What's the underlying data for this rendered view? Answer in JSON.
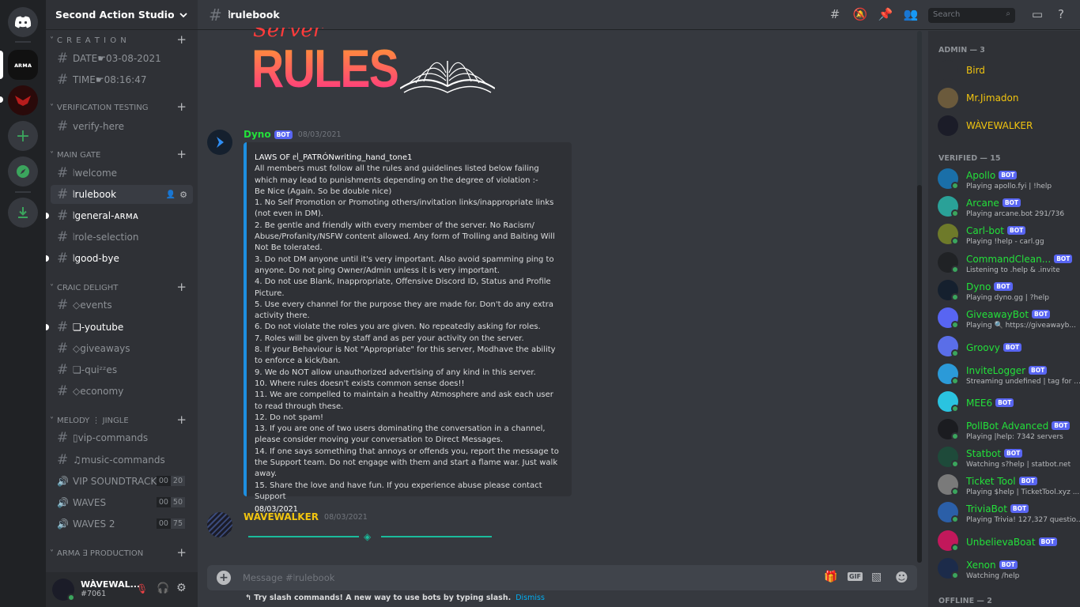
{
  "server": {
    "name": "Second Action Studio"
  },
  "categories": [
    {
      "name": "C R E A T I O N"
    },
    {
      "name": "VERIFICATION TESTING"
    },
    {
      "name": "MAIN GATE"
    },
    {
      "name": "CRAIC DELIGHT"
    },
    {
      "name": "MELODY ⋮ JINGLE"
    },
    {
      "name": "ARMA ∃ PRODUCTION"
    }
  ],
  "channels": {
    "date": "DATE☛03-08-2021",
    "time": "TIME☛08:16:47",
    "verify": "verify-here",
    "welcome": "⦚welcome",
    "rulebook": "⦚rulebook",
    "general": "⦚general-ᴀʀᴍᴀ",
    "role_selection": "⦚role-selection",
    "goodbye": "⦚good-bye",
    "events": "◇events",
    "youtube": "❏-youtube",
    "giveaways": "◇giveaways",
    "quizzes": "❏-quiᶻᶻes",
    "economy": "◇economy",
    "vip_commands": "▯vip-commands",
    "music_commands": "♫music-commands"
  },
  "voice": [
    {
      "name": "VIP SOUNDTRACK",
      "a": "00",
      "b": "20"
    },
    {
      "name": "WAVES",
      "a": "00",
      "b": "50"
    },
    {
      "name": "WAVES 2",
      "a": "00",
      "b": "75"
    }
  ],
  "user": {
    "name": "WÀVEWAL...",
    "tag": "#7061"
  },
  "topbar": {
    "channel": "⦚rulebook",
    "search_placeholder": "Search"
  },
  "banner": {
    "small": "Server",
    "big": "RULES"
  },
  "messages": [
    {
      "author": "Dyno",
      "bot": "BOT",
      "time": "08/03/2021"
    },
    {
      "author": "WÀVEWALKER",
      "time": "08/03/2021"
    }
  ],
  "embed": {
    "title": "LAWS OF ᥱᥣ_PATRÓNwriting_hand_tone1",
    "lines": [
      "All members must follow all the rules and guidelines listed below failing which may lead to punishments depending on the degree of violation :-",
      "Be Nice (Again. So be double nice)",
      "1. No Self Promotion or Promoting others/invitation links/inappropriate links (not even in DM).",
      "2. Be gentle and friendly with every member of the server. No Racism/ Abuse/Profanity/NSFW content allowed. Any form of Trolling and Baiting Will Not Be tolerated.",
      "3. Do not DM anyone until it's very important. Also avoid spamming ping to anyone. Do not ping Owner/Admin unless it is very important.",
      "4. Do not use Blank, Inappropriate, Offensive Discord ID, Status and Profile Picture.",
      "5. Use every channel for the purpose they are made for. Don't do any extra activity there.",
      "6. Do not violate the roles you are given. No repeatedly asking for roles.",
      "7. Roles will be given by staff and as per your activity on the server.",
      "8. If your Behaviour is Not \"Appropriate\" for this server, Modhave the ability to enforce a kick/ban.",
      "9. We do NOT allow unauthorized advertising of any kind in this server.",
      "10. Where rules doesn't exists common sense does!!",
      "11. We are compelled to maintain a healthy Atmosphere and ask each user to read through these.",
      "12. Do not spam!",
      "13. If you are one of two users dominating the conversation in a channel, please consider moving your conversation to Direct Messages.",
      "14. If one says something that annoys or offends you, report the message to the Support team. Do not engage with them and start a flame war. Just walk away.",
      "15. Share the love and have fun. If you experience abuse please contact Support"
    ],
    "footer": "08/03/2021"
  },
  "composer": {
    "placeholder": "Message #⦚rulebook",
    "gif": "GIF"
  },
  "tip": {
    "text": "Try slash commands! A new way to use bots by typing slash.",
    "dismiss": "Dismiss"
  },
  "members": {
    "admin_header": "ADMIN — 3",
    "verified_header": "VERIFIED — 15",
    "offline_header": "OFFLINE — 2",
    "admins": [
      {
        "name": "Bird",
        "color": "#f1c40f",
        "av": "#2f3136"
      },
      {
        "name": "Mr.Jimadon",
        "color": "#f1c40f",
        "av": "#6b5a3c"
      },
      {
        "name": "WÀVEWALKER",
        "color": "#f1c40f",
        "av": "#1b1c28"
      }
    ],
    "verified": [
      {
        "name": "Apollo",
        "activity": "Playing apollo.fyi | !help",
        "av": "#1a6fa8"
      },
      {
        "name": "Arcane",
        "activity": "Playing arcane.bot 291/736",
        "av": "#2aa198"
      },
      {
        "name": "Carl-bot",
        "activity": "Playing !help - carl.gg",
        "av": "#6e7a2a"
      },
      {
        "name": "CommandClean...",
        "activity": "Listening to .help & .invite",
        "av": "#202225"
      },
      {
        "name": "Dyno",
        "activity": "Playing dyno.gg | ?help",
        "av": "#15202e"
      },
      {
        "name": "GiveawayBot",
        "activity": "Playing 🔍 https://giveawayb...",
        "av": "#5865f2"
      },
      {
        "name": "Groovy",
        "activity": "",
        "av": "#5a6ee8"
      },
      {
        "name": "InviteLogger",
        "activity": "Streaming undefined | tag for ...",
        "av": "#2b9ad8"
      },
      {
        "name": "MEE6",
        "activity": "",
        "av": "#2ac3e0"
      },
      {
        "name": "PollBot Advanced",
        "activity": "Playing |help: 7342 servers",
        "av": "#1b1c20"
      },
      {
        "name": "Statbot",
        "activity": "Watching s?help | statbot.net",
        "av": "#1e4a3a"
      },
      {
        "name": "Ticket Tool",
        "activity": "Playing $help | TicketTool.xyz ...",
        "av": "#7a7a7a"
      },
      {
        "name": "TriviaBot",
        "activity": "Playing Trivia! 127,327 questio...",
        "av": "#2b5fa8"
      },
      {
        "name": "UnbelievaBoat",
        "activity": "",
        "av": "#c2185b"
      },
      {
        "name": "Xenon",
        "activity": "Watching /help",
        "av": "#1c2b4a"
      }
    ]
  }
}
